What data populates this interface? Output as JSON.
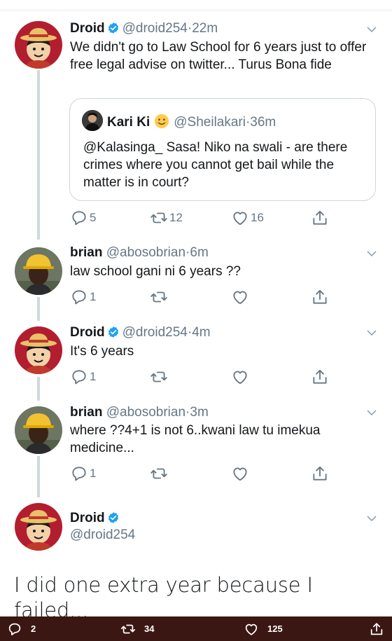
{
  "tweets": [
    {
      "name": "Droid",
      "verified": true,
      "handle": "@droid254",
      "time": "22m",
      "text": "We didn't go to Law School for 6 years just to offer free legal advise on twitter... Turus Bona fide",
      "quote": {
        "name": "Kari Ki",
        "emoji": "smiling-face-icon",
        "handle": "@Sheilakari",
        "time": "36m",
        "text": "@Kalasinga_ Sasa! Niko na swali - are there crimes where you cannot get bail while the matter is in court?"
      },
      "replies": "5",
      "retweets": "12",
      "likes": "16"
    },
    {
      "name": "brian",
      "verified": false,
      "handle": "@abosobrian",
      "time": "6m",
      "text": "law school gani ni 6 years ??",
      "replies": "1",
      "retweets": "",
      "likes": ""
    },
    {
      "name": "Droid",
      "verified": true,
      "handle": "@droid254",
      "time": "4m",
      "text": "It's 6 years",
      "replies": "1",
      "retweets": "",
      "likes": ""
    },
    {
      "name": "brian",
      "verified": false,
      "handle": "@abosobrian",
      "time": "3m",
      "text": "where ??4+1 is not 6..kwani law tu imekua medicine...",
      "replies": "1",
      "retweets": "",
      "likes": ""
    }
  ],
  "final_tweet": {
    "name": "Droid",
    "verified": true,
    "handle": "@droid254",
    "text": "I did one extra year because I failed..."
  },
  "separator": "·",
  "bottom_bar": {
    "replies": "2",
    "retweets": "34",
    "likes": "125"
  },
  "colors": {
    "accent": "#1da1f2",
    "muted": "#657786",
    "bottom_bar": "#3b1713"
  }
}
